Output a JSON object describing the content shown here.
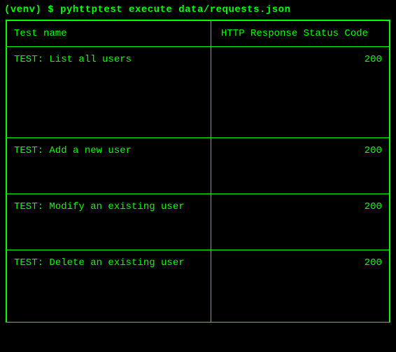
{
  "prompt": {
    "prefix": "(venv) $ ",
    "command": "pyhttptest execute data/requests.json"
  },
  "table": {
    "headers": {
      "name": "Test name",
      "code": "HTTP Response Status Code"
    },
    "rows": [
      {
        "name": "TEST: List all users",
        "code": "200"
      },
      {
        "name": "TEST: Add a new user",
        "code": "200"
      },
      {
        "name": "TEST: Modify an existing user",
        "code": "200"
      },
      {
        "name": "TEST: Delete an existing user",
        "code": "200"
      }
    ]
  }
}
